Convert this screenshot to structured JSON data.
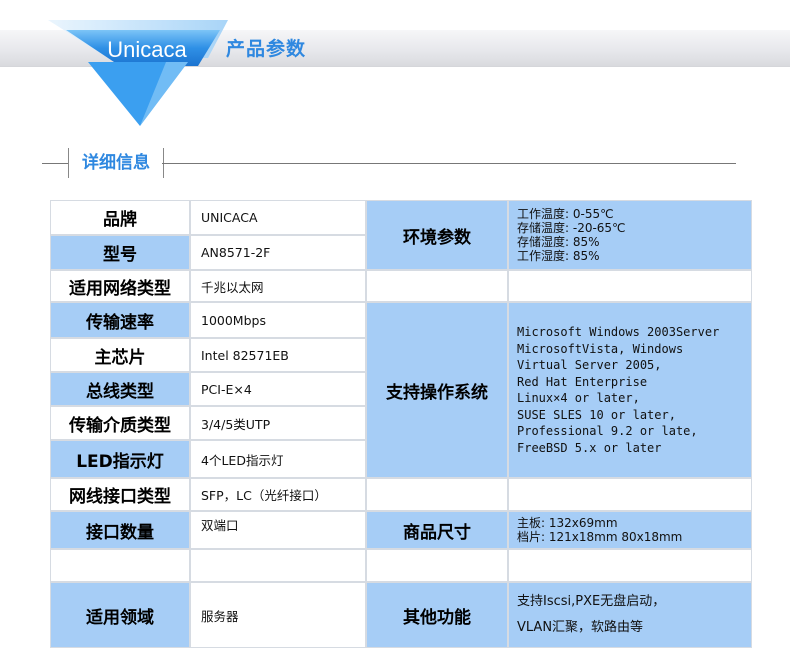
{
  "header": {
    "brand": "Unicaca",
    "section_title": "产品参数",
    "detail_label": "详细信息"
  },
  "left_rows": [
    {
      "label": "品牌",
      "value": "UNICACA"
    },
    {
      "label": "型号",
      "value": "AN8571-2F"
    },
    {
      "label": "适用网络类型",
      "value": "千兆以太网"
    },
    {
      "label": "传输速率",
      "value": "1000Mbps"
    },
    {
      "label": "主芯片",
      "value": "Intel 82571EB"
    },
    {
      "label": "总线类型",
      "value": "PCI-E×4"
    },
    {
      "label": "传输介质类型",
      "value": "3/4/5类UTP"
    },
    {
      "label": "LED指示灯",
      "value": "4个LED指示灯"
    },
    {
      "label": "网线接口类型",
      "value": "SFP，LC（光纤接口）"
    },
    {
      "label": "接口数量",
      "value": "双端口"
    },
    {
      "label": "",
      "value": ""
    },
    {
      "label": "适用领域",
      "value": "服务器"
    }
  ],
  "right_rows": {
    "env": {
      "label": "环境参数",
      "value": "工作温度: 0-55℃\n存储温度: -20-65℃\n存储湿度: 85%\n工作湿度: 85%"
    },
    "os": {
      "label": "支持操作系统",
      "value": "Microsoft Windows 2003Server\nMicrosoftVista, Windows\nVirtual Server 2005,\nRed Hat Enterprise\nLinux×4 or later,\nSUSE SLES 10 or later,\nProfessional 9.2 or late,\nFreeBSD 5.x or later"
    },
    "size": {
      "label": "商品尺寸",
      "value": "主板: 132x69mm\n档片: 121x18mm  80x18mm"
    },
    "misc": {
      "label": "其他功能",
      "value": "支持Iscsi,PXE无盘启动，\nVLAN汇聚，软路由等"
    }
  },
  "colors": {
    "accent": "#2f88e0",
    "cell_blue": "#a6cdf6",
    "badge_blue": "#2e8ee6"
  }
}
